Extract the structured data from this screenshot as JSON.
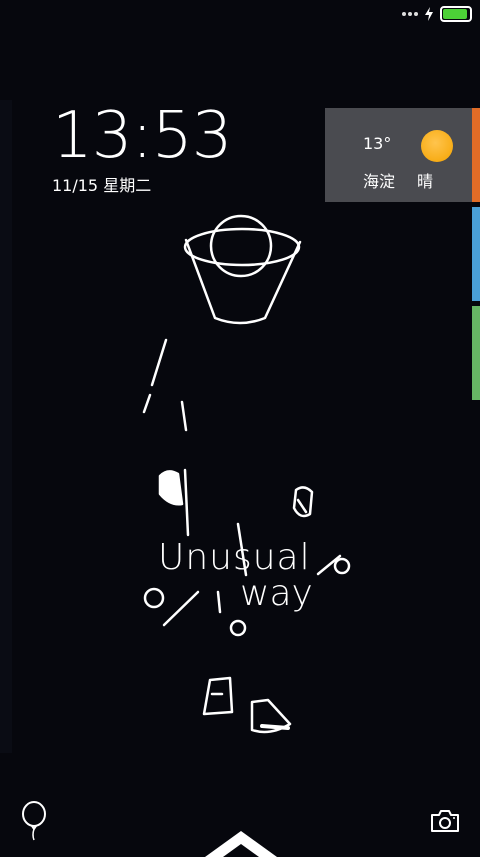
{
  "lockscreen": {
    "time": "13:53",
    "date": "11/15 星期二"
  },
  "weather": {
    "temperature": "13°",
    "city": "海淀",
    "condition": "晴",
    "icon": "sun-icon",
    "icon_color": "#f5a300"
  },
  "side_tabs": {
    "colors": [
      "#e06c27",
      "#4a9fd6",
      "#66b564"
    ]
  },
  "wallpaper": {
    "line1": "Unusual",
    "line2": "way"
  },
  "status_bar": {
    "icons": [
      "signal-dots-icon",
      "charging-bolt-icon",
      "battery-icon"
    ],
    "battery_color": "#4cd137"
  },
  "bottom_bar": {
    "left_icon": "balloon-icon",
    "right_icon": "camera-icon",
    "center_icon": "unlock-arrow-icon"
  }
}
